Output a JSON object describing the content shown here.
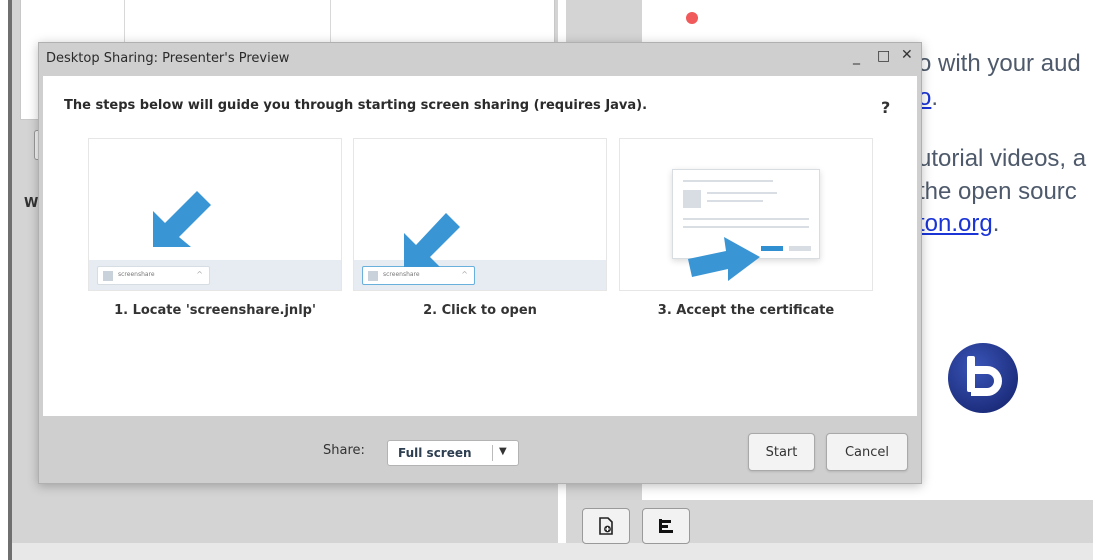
{
  "background": {
    "left_panel_letter": "W",
    "welcome_lines": [
      {
        "text": "o with your aud",
        "link": ""
      },
      {
        "text": "",
        "link": "o"
      },
      {
        "text": "utorial videos, a",
        "link": ""
      },
      {
        "text": "the open sourc",
        "link": ""
      },
      {
        "text": "",
        "link": "ton.org"
      }
    ],
    "welcome_trailing": [
      ".",
      "."
    ],
    "logo": "bigbluebutton-logo",
    "footer_icons": [
      "upload-document-icon",
      "layout-icon"
    ]
  },
  "modal": {
    "title": "Desktop Sharing: Presenter's Preview",
    "controls": {
      "minimize": "_",
      "maximize": "□",
      "close": "✕"
    },
    "intro": "The steps below will guide you through starting screen sharing (requires Java).",
    "help": "?",
    "steps": [
      {
        "label": "1. Locate 'screenshare.jnlp'",
        "file": "screenshare"
      },
      {
        "label": "2. Click to open",
        "file": "screenshare"
      },
      {
        "label": "3. Accept the certificate",
        "file": ""
      }
    ],
    "share": {
      "label": "Share:",
      "value": "Full screen",
      "caret": "▼"
    },
    "buttons": {
      "start": "Start",
      "cancel": "Cancel"
    }
  },
  "colors": {
    "arrow": "#3a95d4",
    "link": "#1a34d6",
    "accent_red": "#f05a5a"
  }
}
